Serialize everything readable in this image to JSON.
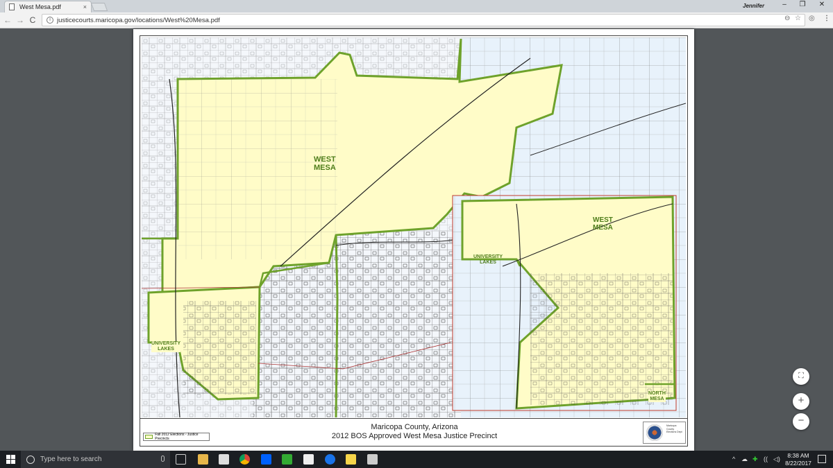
{
  "browser": {
    "tab_title": "West Mesa.pdf",
    "tab_close": "×",
    "user_name": "Jennifer",
    "url": "justicecourts.maricopa.gov/locations/West%20Mesa.pdf",
    "window_controls": {
      "minimize": "–",
      "maximize": "❐",
      "close": "✕"
    },
    "nav": {
      "back": "←",
      "forward": "→",
      "reload": "C"
    },
    "menu": "⋮"
  },
  "pdf": {
    "county": "Maricopa County, Arizona",
    "title": "2012 BOS Approved West Mesa Justice Precinct",
    "legend_label": "Fall 2012 Elections - Justice Precincts",
    "map_labels": {
      "west_mesa_main_1": "WEST",
      "west_mesa_main_2": "MESA",
      "university_lakes_left_1": "UNIVERSITY",
      "university_lakes_left_2": "LAKES",
      "west_mesa_inset_1": "WEST",
      "west_mesa_inset_2": "MESA",
      "university_lakes_inset_1": "UNIVERSITY",
      "university_lakes_inset_2": "LAKES",
      "north_mesa_1": "NORTH",
      "north_mesa_2": "MESA"
    },
    "logo_text": "Maricopa County Elections Dept",
    "colors": {
      "precinct_fill": "#fffcc8",
      "boundary": "#6ea22b",
      "water": "#e8f2fb",
      "inset_border": "#c0392b",
      "road": "#222222"
    },
    "controls": {
      "fit": "⛶",
      "zoom_in": "+",
      "zoom_out": "−"
    }
  },
  "taskbar": {
    "search_placeholder": "Type here to search",
    "time": "8:38 AM",
    "date": "8/22/2017",
    "tray_arrow": "^"
  }
}
